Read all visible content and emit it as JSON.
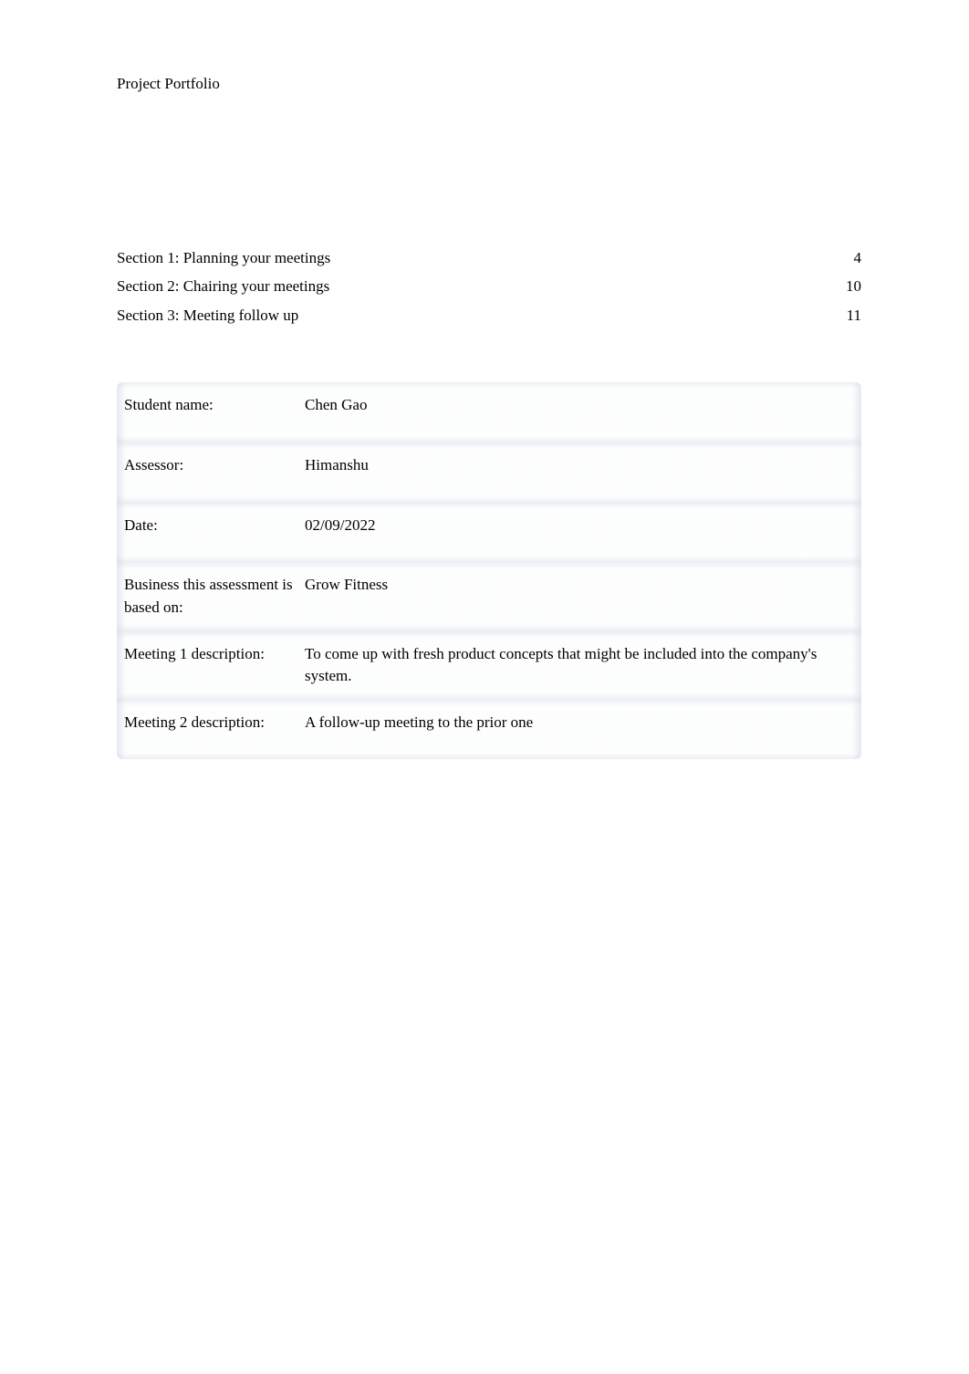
{
  "header": {
    "title": "Project Portfolio"
  },
  "toc": {
    "items": [
      {
        "title": "Section 1: Planning your meetings",
        "page": "4"
      },
      {
        "title": "Section 2: Chairing your meetings",
        "page": "10"
      },
      {
        "title": "Section 3: Meeting follow up",
        "page": "11"
      }
    ]
  },
  "info": {
    "rows": [
      {
        "label": "Student name:",
        "value": "Chen Gao"
      },
      {
        "label": "Assessor:",
        "value": "Himanshu"
      },
      {
        "label": "Date:",
        "value": "02/09/2022"
      },
      {
        "label": "Business this assessment is based on:",
        "value": "Grow Fitness"
      },
      {
        "label": "Meeting 1 description:",
        "value": "To come up with fresh product concepts that might be included into the company's system."
      },
      {
        "label": "Meeting 2 description:",
        "value": "A follow-up meeting to the prior one"
      }
    ]
  }
}
